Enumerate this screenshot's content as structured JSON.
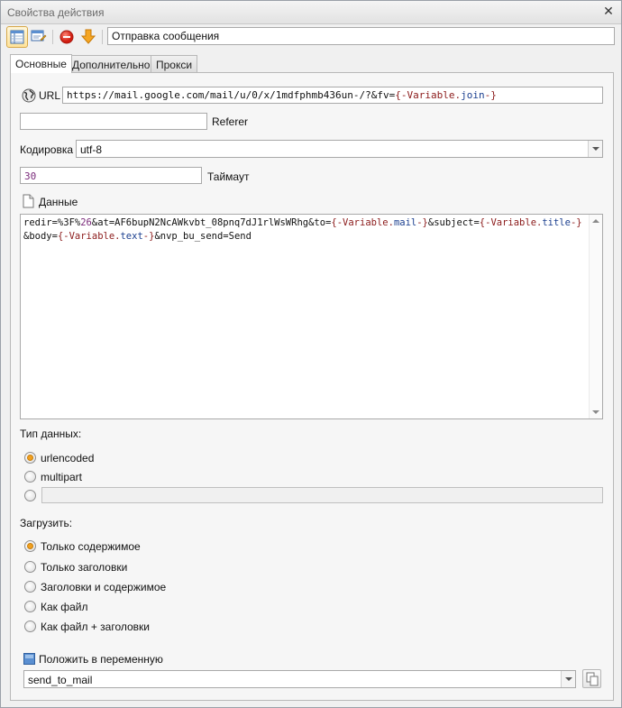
{
  "window": {
    "title": "Свойства действия",
    "close_icon": "close-icon"
  },
  "toolbar": {
    "action_name": "Отправка сообщения"
  },
  "tabs": [
    {
      "label": "Основные",
      "active": true
    },
    {
      "label": "Дополнительно",
      "active": false
    },
    {
      "label": "Прокси",
      "active": false
    }
  ],
  "url": {
    "label": "URL",
    "prefix": "https://mail.google.com/mail/u/0/x/1mdfphmb436un-/?&fv=",
    "var_open": "{-Variable.",
    "var_name": "join",
    "var_close": "-}"
  },
  "referer": {
    "label": "Referer",
    "value": ""
  },
  "encoding": {
    "label": "Кодировка",
    "value": "utf-8"
  },
  "timeout": {
    "label": "Таймаут",
    "value": "30"
  },
  "data_section": {
    "label": "Данные",
    "body": {
      "p1": "redir=%3F%",
      "p1_num": "26",
      "p2": "&at=AF6bupN2NcAWkvbt_08pnq7dJ1rlWsWRhg&to=",
      "v1_open": "{-Variable.",
      "v1_name": "mail",
      "v1_close": "-}",
      "p3": "&subject=",
      "v2_open": "{-Variable.",
      "v2_name": "title",
      "v2_close": "-}",
      "p4": "&body=",
      "v3_open": "{-Variable.",
      "v3_name": "text",
      "v3_close": "-}",
      "p5": "&nvp_bu_send=Send"
    }
  },
  "data_type": {
    "label": "Тип данных:",
    "options": [
      {
        "label": "urlencoded",
        "checked": true
      },
      {
        "label": "multipart",
        "checked": false
      }
    ],
    "custom_value": ""
  },
  "load": {
    "label": "Загрузить:",
    "options": [
      {
        "label": "Только содержимое",
        "checked": true
      },
      {
        "label": "Только заголовки",
        "checked": false
      },
      {
        "label": "Заголовки и содержимое",
        "checked": false
      },
      {
        "label": "Как файл",
        "checked": false
      },
      {
        "label": "Как файл + заголовки",
        "checked": false
      }
    ]
  },
  "variable": {
    "label": "Положить в переменную",
    "value": "send_to_mail"
  },
  "colors": {
    "accent": "#f0a020",
    "var_brace": "#8b1a1a",
    "var_name": "#1b3f8f"
  }
}
